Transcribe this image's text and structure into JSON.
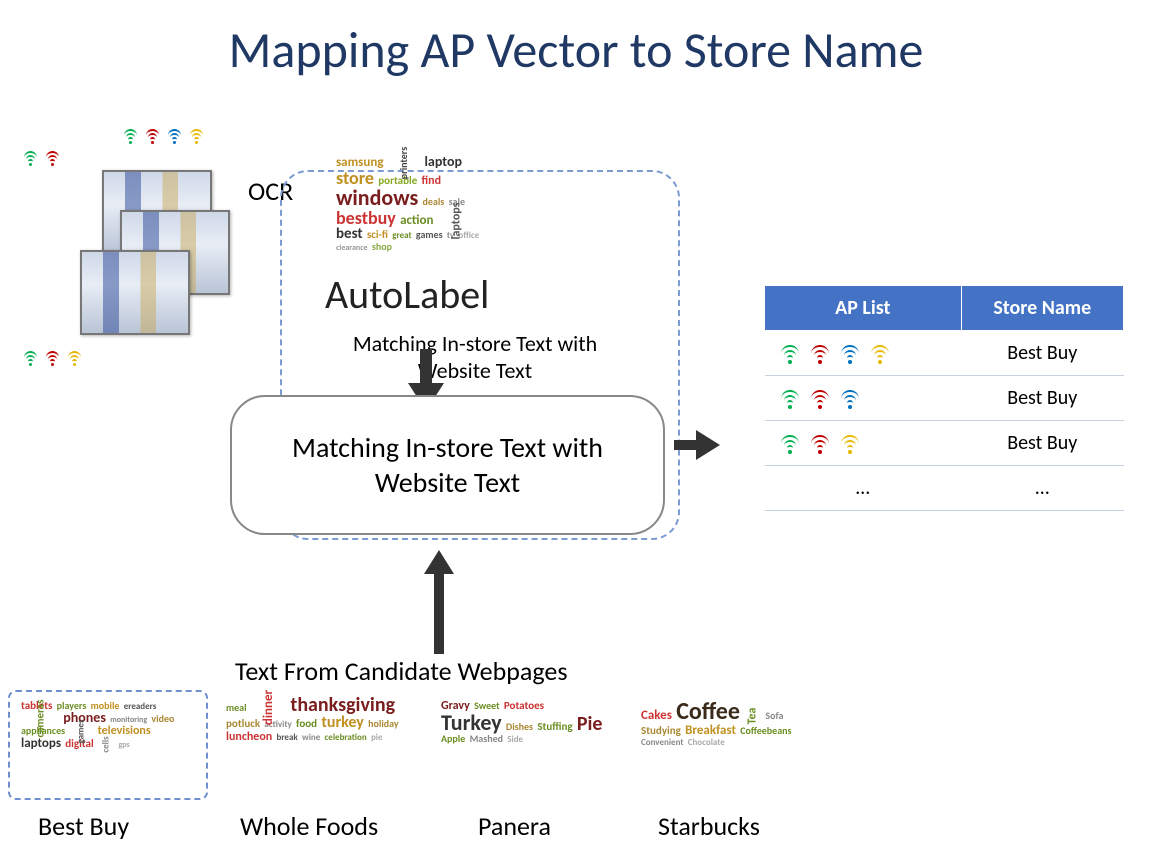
{
  "title": "Mapping AP Vector to Store Name",
  "ocr_label": "OCR",
  "autolabel": {
    "title": "AutoLabel",
    "subtitle": "Matching In-store Text with Website Text",
    "overlay": "Matching In-store Text with Website Text"
  },
  "candidate_label": "Text From Candidate Webpages",
  "table": {
    "headers": [
      "AP List",
      "Store Name"
    ],
    "rows": [
      {
        "ap_colors": [
          "green",
          "red",
          "blue",
          "yellow"
        ],
        "store": "Best Buy"
      },
      {
        "ap_colors": [
          "green",
          "red",
          "blue"
        ],
        "store": "Best Buy"
      },
      {
        "ap_colors": [
          "green",
          "red",
          "yellow"
        ],
        "store": "Best Buy"
      },
      {
        "ap_colors": [],
        "store": "…",
        "ap_text": "…"
      }
    ]
  },
  "candidates": [
    {
      "name": "Best Buy"
    },
    {
      "name": "Whole Foods"
    },
    {
      "name": "Panera"
    },
    {
      "name": "Starbucks"
    }
  ],
  "instore_words": [
    {
      "t": "samsung",
      "s": 13,
      "c": "#c09020"
    },
    {
      "t": "printers",
      "s": 10,
      "c": "#444",
      "r": -90
    },
    {
      "t": "laptop",
      "s": 14,
      "c": "#333"
    },
    {
      "t": "store",
      "s": 18,
      "c": "#c09020"
    },
    {
      "t": "portable",
      "s": 11,
      "c": "#8a2"
    },
    {
      "t": "find",
      "s": 12,
      "c": "#c33"
    },
    {
      "t": "windows",
      "s": 22,
      "c": "#7a1d1d"
    },
    {
      "t": "deals",
      "s": 10,
      "c": "#a83"
    },
    {
      "t": "sale",
      "s": 10,
      "c": "#888"
    },
    {
      "t": "bestbuy",
      "s": 18,
      "c": "#c33"
    },
    {
      "t": "action",
      "s": 13,
      "c": "#6b8e23"
    },
    {
      "t": "laptops",
      "s": 12,
      "c": "#555",
      "r": -90
    },
    {
      "t": "best",
      "s": 15,
      "c": "#333"
    },
    {
      "t": "sci-fi",
      "s": 11,
      "c": "#c09020"
    },
    {
      "t": "great",
      "s": 9,
      "c": "#6b8e23"
    },
    {
      "t": "games",
      "s": 10,
      "c": "#555"
    },
    {
      "t": "tv",
      "s": 9,
      "c": "#888"
    },
    {
      "t": "office",
      "s": 9,
      "c": "#aaa"
    },
    {
      "t": "clearance",
      "s": 8,
      "c": "#999"
    },
    {
      "t": "shop",
      "s": 10,
      "c": "#8a4"
    }
  ],
  "cloud_bestbuy": [
    {
      "t": "tablets",
      "s": 11,
      "c": "#c33"
    },
    {
      "t": "players",
      "s": 10,
      "c": "#6b8e23"
    },
    {
      "t": "mobile",
      "s": 10,
      "c": "#c09020"
    },
    {
      "t": "ereaders",
      "s": 9,
      "c": "#555"
    },
    {
      "t": "cameras",
      "s": 11,
      "c": "#6b8e23",
      "r": -90
    },
    {
      "t": "phones",
      "s": 14,
      "c": "#7a1d1d"
    },
    {
      "t": "monitoring",
      "s": 8,
      "c": "#888"
    },
    {
      "t": "video",
      "s": 10,
      "c": "#a83"
    },
    {
      "t": "appliances",
      "s": 10,
      "c": "#6b8e23"
    },
    {
      "t": "games",
      "s": 9,
      "c": "#555",
      "r": -90
    },
    {
      "t": "televisions",
      "s": 12,
      "c": "#c09020"
    },
    {
      "t": "laptops",
      "s": 13,
      "c": "#333"
    },
    {
      "t": "digital",
      "s": 11,
      "c": "#c33"
    },
    {
      "t": "cells",
      "s": 9,
      "c": "#888",
      "r": -90
    },
    {
      "t": "gps",
      "s": 8,
      "c": "#aaa"
    }
  ],
  "cloud_wholefoods": [
    {
      "t": "meal",
      "s": 10,
      "c": "#6b8e23"
    },
    {
      "t": "dinner",
      "s": 13,
      "c": "#c33",
      "r": -90
    },
    {
      "t": "thanksgiving",
      "s": 20,
      "c": "#7a1d1d"
    },
    {
      "t": "potluck",
      "s": 11,
      "c": "#a83"
    },
    {
      "t": "activity",
      "s": 9,
      "c": "#888"
    },
    {
      "t": "food",
      "s": 11,
      "c": "#6b8e23"
    },
    {
      "t": "turkey",
      "s": 16,
      "c": "#c09020"
    },
    {
      "t": "holiday",
      "s": 10,
      "c": "#a83"
    },
    {
      "t": "luncheon",
      "s": 12,
      "c": "#c33"
    },
    {
      "t": "break",
      "s": 9,
      "c": "#555"
    },
    {
      "t": "wine",
      "s": 9,
      "c": "#888"
    },
    {
      "t": "celebration",
      "s": 9,
      "c": "#6b8e23"
    },
    {
      "t": "pie",
      "s": 9,
      "c": "#aaa"
    }
  ],
  "cloud_panera": [
    {
      "t": "Gravy",
      "s": 12,
      "c": "#7a1d1d"
    },
    {
      "t": "Sweet",
      "s": 10,
      "c": "#6b8e23"
    },
    {
      "t": "Potatoes",
      "s": 11,
      "c": "#c33"
    },
    {
      "t": "Turkey",
      "s": 22,
      "c": "#333"
    },
    {
      "t": "Dishes",
      "s": 10,
      "c": "#a83"
    },
    {
      "t": "Stuffing",
      "s": 11,
      "c": "#6b8e23"
    },
    {
      "t": "Pie",
      "s": 20,
      "c": "#7a1d1d"
    },
    {
      "t": "Apple",
      "s": 10,
      "c": "#6b8e23"
    },
    {
      "t": "Mashed",
      "s": 10,
      "c": "#888"
    },
    {
      "t": "Side",
      "s": 9,
      "c": "#aaa"
    }
  ],
  "cloud_starbucks": [
    {
      "t": "Cakes",
      "s": 13,
      "c": "#c33"
    },
    {
      "t": "Coffee",
      "s": 24,
      "c": "#3a2a1a"
    },
    {
      "t": "Tea",
      "s": 12,
      "c": "#6b8e23",
      "r": -90
    },
    {
      "t": "Sofa",
      "s": 10,
      "c": "#888"
    },
    {
      "t": "Studying",
      "s": 11,
      "c": "#a83"
    },
    {
      "t": "Breakfast",
      "s": 13,
      "c": "#c09020"
    },
    {
      "t": "Coffeebeans",
      "s": 10,
      "c": "#6b8e23"
    },
    {
      "t": "Convenient",
      "s": 9,
      "c": "#888"
    },
    {
      "t": "Chocolate",
      "s": 9,
      "c": "#aaa"
    }
  ]
}
